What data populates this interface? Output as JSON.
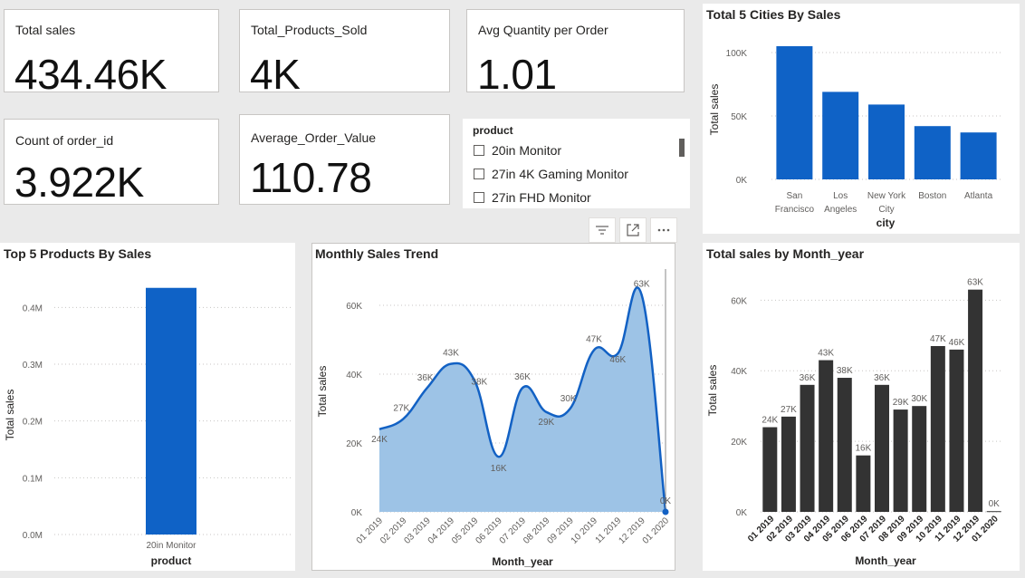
{
  "kpis": {
    "total_sales": {
      "label": "Total sales",
      "value": "434.46K"
    },
    "total_products": {
      "label": "Total_Products_Sold",
      "value": "4K"
    },
    "avg_qty": {
      "label": "Avg Quantity per Order",
      "value": "1.01"
    },
    "count_orders": {
      "label": "Count of order_id",
      "value": "3.922K"
    },
    "avg_order_value": {
      "label": "Average_Order_Value",
      "value": "110.78"
    }
  },
  "slicer": {
    "title": "product",
    "items": [
      "20in Monitor",
      "27in 4K Gaming Monitor",
      "27in FHD Monitor"
    ]
  },
  "toolbar": {
    "icons": [
      "filter-icon",
      "focus-mode-icon",
      "more-options-icon"
    ]
  },
  "colors": {
    "blue": "#0f62c6",
    "area_fill": "#9dc3e6",
    "line": "#1261c4",
    "dark_bar": "#333333"
  },
  "chart_data": [
    {
      "id": "cities",
      "type": "bar",
      "title": "Total 5 Cities By Sales",
      "xlabel": "city",
      "ylabel": "Total sales",
      "categories": [
        [
          "San",
          "Francisco"
        ],
        [
          "Los",
          "Angeles"
        ],
        [
          "New York",
          "City"
        ],
        [
          "Boston"
        ],
        [
          "Atlanta"
        ]
      ],
      "values": [
        105000,
        69000,
        59000,
        42000,
        37000
      ],
      "ylim": [
        0,
        110000
      ],
      "yticks": [
        {
          "v": 0,
          "label": "0K"
        },
        {
          "v": 50000,
          "label": "50K"
        },
        {
          "v": 100000,
          "label": "100K"
        }
      ],
      "color": "#0f62c6"
    },
    {
      "id": "products",
      "type": "bar",
      "title": "Top 5 Products By Sales",
      "xlabel": "product",
      "ylabel": "Total sales",
      "categories": [
        "20in Monitor"
      ],
      "values": [
        434460
      ],
      "ylim": [
        0,
        450000
      ],
      "yticks": [
        {
          "v": 0,
          "label": "0.0M"
        },
        {
          "v": 100000,
          "label": "0.1M"
        },
        {
          "v": 200000,
          "label": "0.2M"
        },
        {
          "v": 300000,
          "label": "0.3M"
        },
        {
          "v": 400000,
          "label": "0.4M"
        }
      ],
      "color": "#0f62c6"
    },
    {
      "id": "trend",
      "type": "area",
      "title": "Monthly Sales Trend",
      "xlabel": "Month_year",
      "ylabel": "Total sales",
      "categories": [
        "01 2019",
        "02 2019",
        "03 2019",
        "04 2019",
        "05 2019",
        "06 2019",
        "07 2019",
        "08 2019",
        "09 2019",
        "10 2019",
        "11 2019",
        "12 2019",
        "01 2020"
      ],
      "values": [
        24000,
        27000,
        36000,
        43000,
        38000,
        16000,
        36000,
        29000,
        30000,
        47000,
        46000,
        63000,
        0
      ],
      "labels": [
        "24K",
        "27K",
        "36K",
        "43K",
        "38K",
        "16K",
        "36K",
        "29K",
        "30K",
        "47K",
        "46K",
        "63K",
        "0K"
      ],
      "ylim": [
        0,
        70000
      ],
      "yticks": [
        {
          "v": 0,
          "label": "0K"
        },
        {
          "v": 20000,
          "label": "20K"
        },
        {
          "v": 40000,
          "label": "40K"
        },
        {
          "v": 60000,
          "label": "60K"
        }
      ]
    },
    {
      "id": "monthly",
      "type": "bar",
      "title": "Total sales by Month_year",
      "xlabel": "Month_year",
      "ylabel": "Total sales",
      "categories": [
        "01 2019",
        "02 2019",
        "03 2019",
        "04 2019",
        "05 2019",
        "06 2019",
        "07 2019",
        "08 2019",
        "09 2019",
        "10 2019",
        "11 2019",
        "12 2019",
        "01 2020"
      ],
      "values": [
        24000,
        27000,
        36000,
        43000,
        38000,
        16000,
        36000,
        29000,
        30000,
        47000,
        46000,
        63000,
        200
      ],
      "labels": [
        "24K",
        "27K",
        "36K",
        "43K",
        "38K",
        "16K",
        "36K",
        "29K",
        "30K",
        "47K",
        "46K",
        "63K",
        "0K"
      ],
      "ylim": [
        0,
        66000
      ],
      "yticks": [
        {
          "v": 0,
          "label": "0K"
        },
        {
          "v": 20000,
          "label": "20K"
        },
        {
          "v": 40000,
          "label": "40K"
        },
        {
          "v": 60000,
          "label": "60K"
        }
      ],
      "color": "#333333"
    }
  ]
}
